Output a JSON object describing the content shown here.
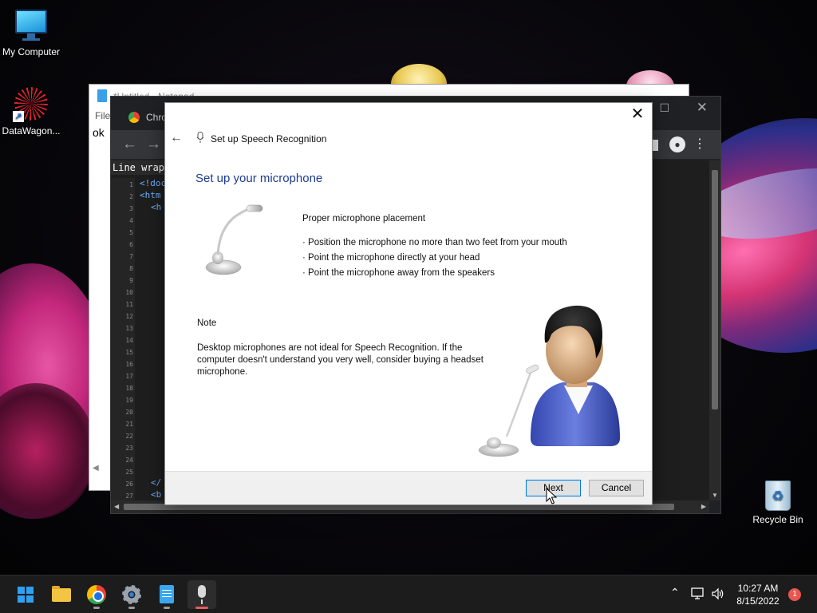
{
  "desktop": {
    "icons": [
      {
        "label": "My Computer",
        "icon": "computer-icon"
      },
      {
        "label": "DataWagon...",
        "icon": "datawagon-icon"
      },
      {
        "label": "Recycle Bin",
        "icon": "recycle-bin-icon"
      }
    ]
  },
  "notepad": {
    "title": "*Untitled - Notepad",
    "menu_file": "File",
    "content": "ok"
  },
  "chrome": {
    "tab_title": "Chro",
    "editor_header": "Line wrap",
    "line_numbers": [
      "1",
      "2",
      "3",
      "4",
      "5",
      "6",
      "7",
      "8",
      "9",
      "10",
      "11",
      "12",
      "13",
      "14",
      "15",
      "16",
      "17",
      "18",
      "19",
      "20",
      "21",
      "22",
      "23",
      "24",
      "25",
      "26",
      "27"
    ],
    "code_lines": [
      "<!doc",
      "<htm",
      "<h",
      "",
      "",
      "",
      "</",
      "<b"
    ]
  },
  "dialog": {
    "wizard_title": "Set up Speech Recognition",
    "heading": "Set up your microphone",
    "placement_title": "Proper microphone placement",
    "tips": [
      "· Position the microphone no more than two feet from your mouth",
      "· Point the microphone directly at your head",
      "· Point the microphone away from the speakers"
    ],
    "note_title": "Note",
    "note_body": "Desktop microphones are not ideal for Speech Recognition. If the computer doesn't understand you very well, consider buying a headset microphone.",
    "next_button": "Next",
    "cancel_button": "Cancel"
  },
  "taskbar": {
    "apps": [
      "start",
      "file-explorer",
      "chrome",
      "settings",
      "notepad",
      "speech-recognition"
    ],
    "time": "10:27 AM",
    "date": "8/15/2022",
    "notification_count": "1"
  },
  "colors": {
    "heading": "#1c3c92",
    "accent": "#0078d7",
    "taskbar": "#1c1c1c"
  }
}
